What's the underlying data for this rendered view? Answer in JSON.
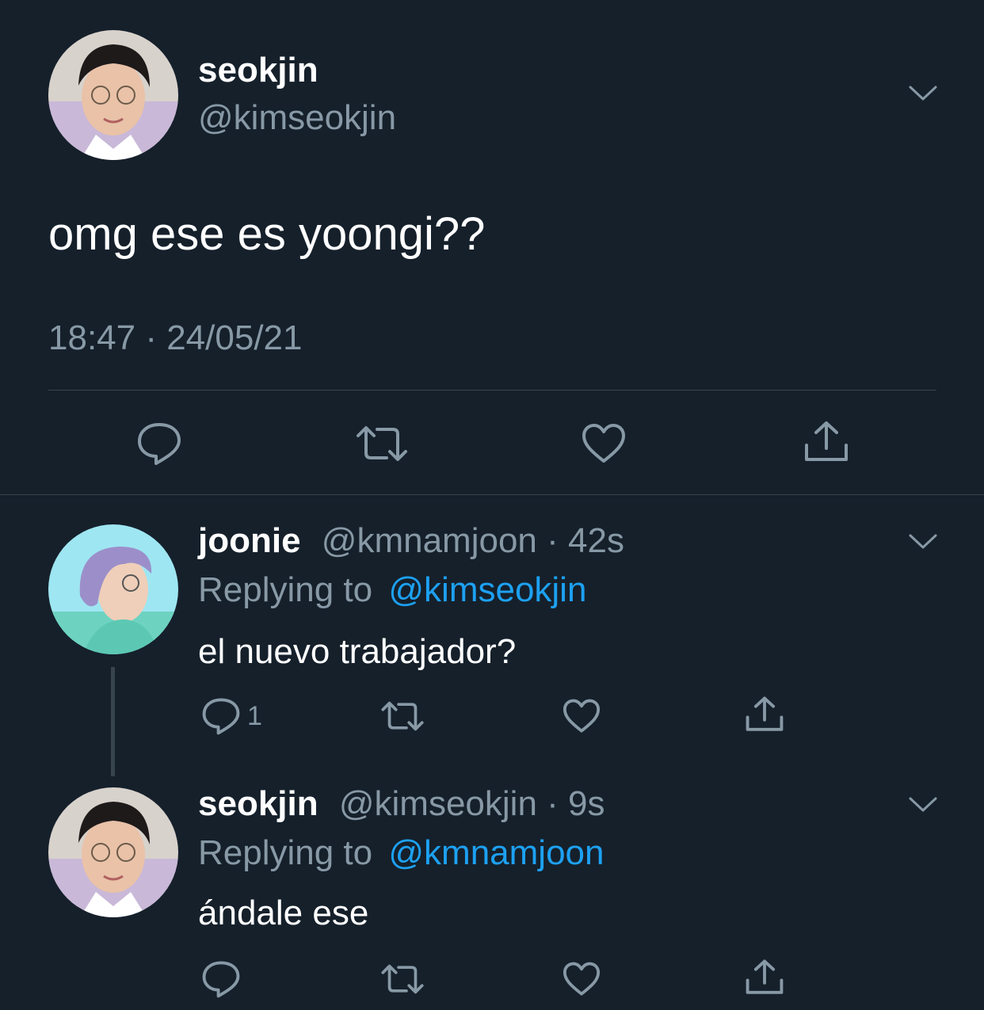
{
  "main_tweet": {
    "display_name": "seokjin",
    "handle": "@kimseokjin",
    "avatar": "avatar-seokjin",
    "text": "omg ese es yoongi??",
    "timestamp": "18:47 · 24/05/21",
    "actions": {
      "reply_icon": "reply-icon",
      "retweet_icon": "retweet-icon",
      "like_icon": "heart-icon",
      "share_icon": "share-icon"
    }
  },
  "replies": [
    {
      "display_name": "joonie",
      "handle": "@kmnamjoon",
      "time": "42s",
      "replying_prefix": "Replying to",
      "replying_to": "@kimseokjin",
      "text": "el nuevo trabajador?",
      "reply_count": "1"
    },
    {
      "display_name": "seokjin",
      "handle": "@kimseokjin",
      "time": "9s",
      "replying_prefix": "Replying to",
      "replying_to": "@kmnamjoon",
      "text": "ándale ese",
      "reply_count": ""
    }
  ],
  "colors": {
    "background": "#15202b",
    "text": "#ffffff",
    "secondary": "#8899a6",
    "link": "#1da1f2",
    "divider": "#38444d"
  }
}
